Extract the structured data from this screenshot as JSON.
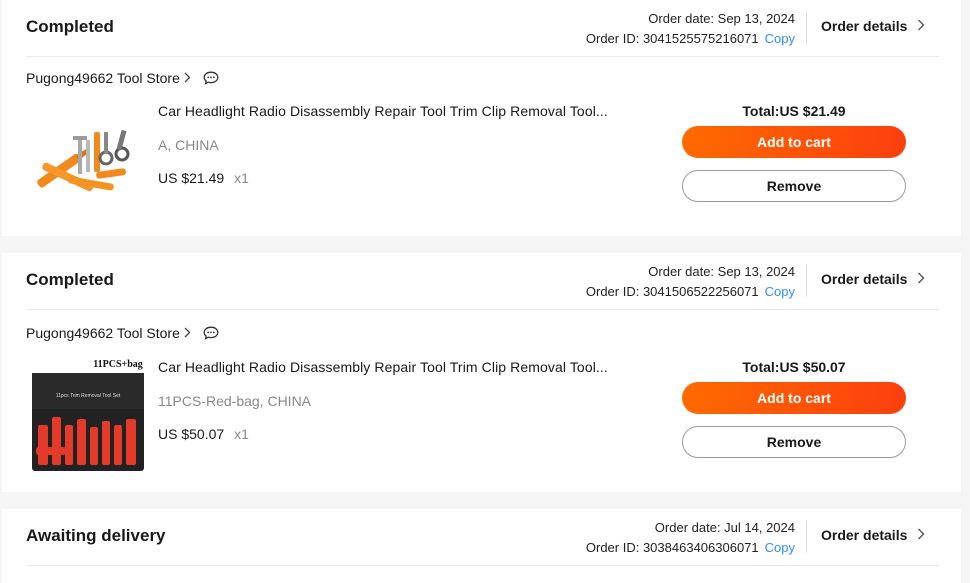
{
  "orders": [
    {
      "status": "Completed",
      "order_date_label": "Order date: Sep 13, 2024",
      "order_id_label": "Order ID: 3041525575216071",
      "copy_label": "Copy",
      "details_label": "Order details",
      "store_name": "Pugong49662 Tool Store",
      "item_title": "Car Headlight Radio Disassembly Repair Tool Trim Clip Removal Tool...",
      "variant": "A, CHINA",
      "unit_price": "US $21.49",
      "quantity": "x1",
      "total": "Total:US $21.49",
      "add_to_cart_label": "Add to cart",
      "remove_label": "Remove"
    },
    {
      "status": "Completed",
      "order_date_label": "Order date: Sep 13, 2024",
      "order_id_label": "Order ID: 3041506522256071",
      "copy_label": "Copy",
      "details_label": "Order details",
      "store_name": "Pugong49662 Tool Store",
      "item_title": "Car Headlight Radio Disassembly Repair Tool Trim Clip Removal Tool...",
      "variant": "11PCS-Red-bag, CHINA",
      "unit_price": "US $50.07",
      "quantity": "x1",
      "total": "Total:US $50.07",
      "add_to_cart_label": "Add to cart",
      "remove_label": "Remove",
      "image_caption": "11PCS+bag",
      "image_bag_text": "11pcs Trim Removal Tool Set"
    },
    {
      "status": "Awaiting delivery",
      "order_date_label": "Order date: Jul 14, 2024",
      "order_id_label": "Order ID: 3038463406306071",
      "copy_label": "Copy",
      "details_label": "Order details"
    }
  ],
  "icons": {
    "chevron_right": "chevron-right-icon",
    "chat": "chat-icon"
  },
  "colors": {
    "accent": "#fd3f0e",
    "accent_start": "#ff6a00",
    "link": "#2f8dff",
    "muted_text": "#888888"
  }
}
